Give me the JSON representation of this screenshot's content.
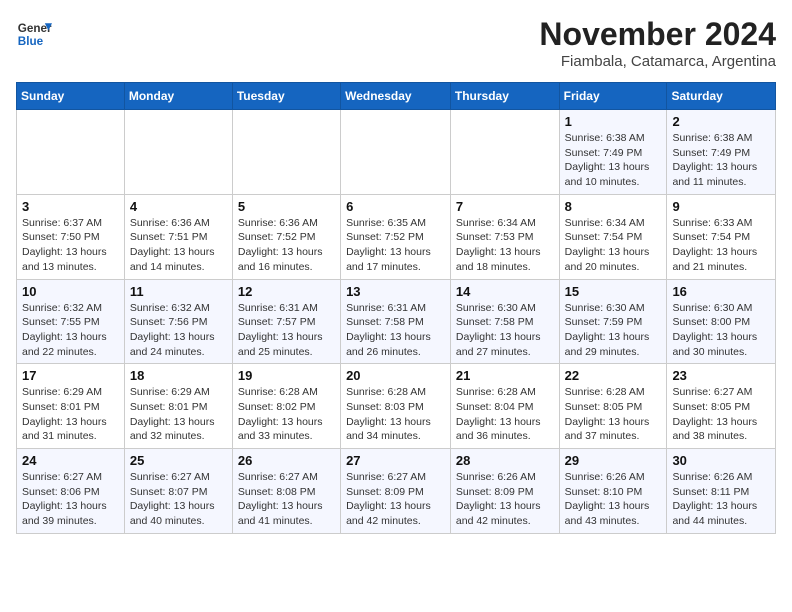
{
  "header": {
    "logo_line1": "General",
    "logo_line2": "Blue",
    "month_year": "November 2024",
    "location": "Fiambala, Catamarca, Argentina"
  },
  "calendar": {
    "days_of_week": [
      "Sunday",
      "Monday",
      "Tuesday",
      "Wednesday",
      "Thursday",
      "Friday",
      "Saturday"
    ],
    "weeks": [
      [
        {
          "day": "",
          "detail": ""
        },
        {
          "day": "",
          "detail": ""
        },
        {
          "day": "",
          "detail": ""
        },
        {
          "day": "",
          "detail": ""
        },
        {
          "day": "",
          "detail": ""
        },
        {
          "day": "1",
          "detail": "Sunrise: 6:38 AM\nSunset: 7:49 PM\nDaylight: 13 hours\nand 10 minutes."
        },
        {
          "day": "2",
          "detail": "Sunrise: 6:38 AM\nSunset: 7:49 PM\nDaylight: 13 hours\nand 11 minutes."
        }
      ],
      [
        {
          "day": "3",
          "detail": "Sunrise: 6:37 AM\nSunset: 7:50 PM\nDaylight: 13 hours\nand 13 minutes."
        },
        {
          "day": "4",
          "detail": "Sunrise: 6:36 AM\nSunset: 7:51 PM\nDaylight: 13 hours\nand 14 minutes."
        },
        {
          "day": "5",
          "detail": "Sunrise: 6:36 AM\nSunset: 7:52 PM\nDaylight: 13 hours\nand 16 minutes."
        },
        {
          "day": "6",
          "detail": "Sunrise: 6:35 AM\nSunset: 7:52 PM\nDaylight: 13 hours\nand 17 minutes."
        },
        {
          "day": "7",
          "detail": "Sunrise: 6:34 AM\nSunset: 7:53 PM\nDaylight: 13 hours\nand 18 minutes."
        },
        {
          "day": "8",
          "detail": "Sunrise: 6:34 AM\nSunset: 7:54 PM\nDaylight: 13 hours\nand 20 minutes."
        },
        {
          "day": "9",
          "detail": "Sunrise: 6:33 AM\nSunset: 7:54 PM\nDaylight: 13 hours\nand 21 minutes."
        }
      ],
      [
        {
          "day": "10",
          "detail": "Sunrise: 6:32 AM\nSunset: 7:55 PM\nDaylight: 13 hours\nand 22 minutes."
        },
        {
          "day": "11",
          "detail": "Sunrise: 6:32 AM\nSunset: 7:56 PM\nDaylight: 13 hours\nand 24 minutes."
        },
        {
          "day": "12",
          "detail": "Sunrise: 6:31 AM\nSunset: 7:57 PM\nDaylight: 13 hours\nand 25 minutes."
        },
        {
          "day": "13",
          "detail": "Sunrise: 6:31 AM\nSunset: 7:58 PM\nDaylight: 13 hours\nand 26 minutes."
        },
        {
          "day": "14",
          "detail": "Sunrise: 6:30 AM\nSunset: 7:58 PM\nDaylight: 13 hours\nand 27 minutes."
        },
        {
          "day": "15",
          "detail": "Sunrise: 6:30 AM\nSunset: 7:59 PM\nDaylight: 13 hours\nand 29 minutes."
        },
        {
          "day": "16",
          "detail": "Sunrise: 6:30 AM\nSunset: 8:00 PM\nDaylight: 13 hours\nand 30 minutes."
        }
      ],
      [
        {
          "day": "17",
          "detail": "Sunrise: 6:29 AM\nSunset: 8:01 PM\nDaylight: 13 hours\nand 31 minutes."
        },
        {
          "day": "18",
          "detail": "Sunrise: 6:29 AM\nSunset: 8:01 PM\nDaylight: 13 hours\nand 32 minutes."
        },
        {
          "day": "19",
          "detail": "Sunrise: 6:28 AM\nSunset: 8:02 PM\nDaylight: 13 hours\nand 33 minutes."
        },
        {
          "day": "20",
          "detail": "Sunrise: 6:28 AM\nSunset: 8:03 PM\nDaylight: 13 hours\nand 34 minutes."
        },
        {
          "day": "21",
          "detail": "Sunrise: 6:28 AM\nSunset: 8:04 PM\nDaylight: 13 hours\nand 36 minutes."
        },
        {
          "day": "22",
          "detail": "Sunrise: 6:28 AM\nSunset: 8:05 PM\nDaylight: 13 hours\nand 37 minutes."
        },
        {
          "day": "23",
          "detail": "Sunrise: 6:27 AM\nSunset: 8:05 PM\nDaylight: 13 hours\nand 38 minutes."
        }
      ],
      [
        {
          "day": "24",
          "detail": "Sunrise: 6:27 AM\nSunset: 8:06 PM\nDaylight: 13 hours\nand 39 minutes."
        },
        {
          "day": "25",
          "detail": "Sunrise: 6:27 AM\nSunset: 8:07 PM\nDaylight: 13 hours\nand 40 minutes."
        },
        {
          "day": "26",
          "detail": "Sunrise: 6:27 AM\nSunset: 8:08 PM\nDaylight: 13 hours\nand 41 minutes."
        },
        {
          "day": "27",
          "detail": "Sunrise: 6:27 AM\nSunset: 8:09 PM\nDaylight: 13 hours\nand 42 minutes."
        },
        {
          "day": "28",
          "detail": "Sunrise: 6:26 AM\nSunset: 8:09 PM\nDaylight: 13 hours\nand 42 minutes."
        },
        {
          "day": "29",
          "detail": "Sunrise: 6:26 AM\nSunset: 8:10 PM\nDaylight: 13 hours\nand 43 minutes."
        },
        {
          "day": "30",
          "detail": "Sunrise: 6:26 AM\nSunset: 8:11 PM\nDaylight: 13 hours\nand 44 minutes."
        }
      ]
    ]
  }
}
